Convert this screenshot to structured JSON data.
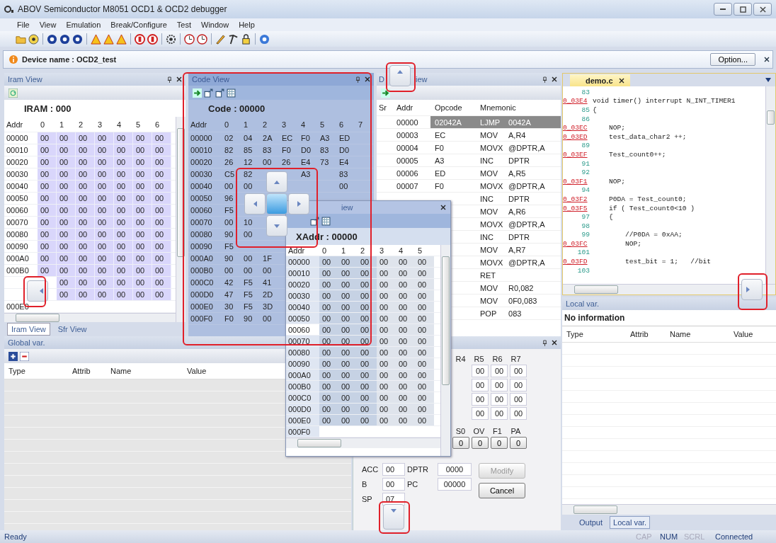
{
  "window": {
    "title": "ABOV Semiconductor M8051 OCD1 & OCD2 debugger"
  },
  "menu": [
    "File",
    "View",
    "Emulation",
    "Break/Configure",
    "Test",
    "Window",
    "Help"
  ],
  "device_bar": {
    "label": "Device name : OCD2_test",
    "button": "Option..."
  },
  "iram_view": {
    "title": "Iram View",
    "label": "IRAM : 000",
    "columns": [
      "Addr",
      "0",
      "1",
      "2",
      "3",
      "4",
      "5",
      "6"
    ],
    "rows": [
      [
        "00000",
        "00",
        "00",
        "00",
        "00",
        "00",
        "00",
        "00"
      ],
      [
        "00010",
        "00",
        "00",
        "00",
        "00",
        "00",
        "00",
        "00"
      ],
      [
        "00020",
        "00",
        "00",
        "00",
        "00",
        "00",
        "00",
        "00"
      ],
      [
        "00030",
        "00",
        "00",
        "00",
        "00",
        "00",
        "00",
        "00"
      ],
      [
        "00040",
        "00",
        "00",
        "00",
        "00",
        "00",
        "00",
        "00"
      ],
      [
        "00050",
        "00",
        "00",
        "00",
        "00",
        "00",
        "00",
        "00"
      ],
      [
        "00060",
        "00",
        "00",
        "00",
        "00",
        "00",
        "00",
        "00"
      ],
      [
        "00070",
        "00",
        "00",
        "00",
        "00",
        "00",
        "00",
        "00"
      ],
      [
        "00080",
        "00",
        "00",
        "00",
        "00",
        "00",
        "00",
        "00"
      ],
      [
        "00090",
        "00",
        "00",
        "00",
        "00",
        "00",
        "00",
        "00"
      ],
      [
        "000A0",
        "00",
        "00",
        "00",
        "00",
        "00",
        "00",
        "00"
      ],
      [
        "000B0",
        "00",
        "00",
        "00",
        "00",
        "00",
        "00",
        "00"
      ],
      [
        null,
        null,
        "00",
        "00",
        "00",
        "00",
        "00",
        "00"
      ],
      [
        null,
        null,
        "00",
        "00",
        "00",
        "00",
        "00",
        "00"
      ],
      [
        "000E0"
      ]
    ]
  },
  "iram_tabs": [
    {
      "label": "Iram View",
      "selected": true
    },
    {
      "label": "Sfr View",
      "selected": false
    }
  ],
  "global_var": {
    "title": "Global var.",
    "columns": [
      "Type",
      "Attrib",
      "Name",
      "Value"
    ]
  },
  "code_view": {
    "title": "Code View",
    "label": "Code : 00000",
    "columns": [
      "Addr",
      "0",
      "1",
      "2",
      "3",
      "4",
      "5",
      "6",
      "7"
    ],
    "rows": [
      [
        "00000",
        "02",
        "04",
        "2A",
        "EC",
        "F0",
        "A3",
        "ED"
      ],
      [
        "00010",
        "82",
        "85",
        "83",
        "F0",
        "D0",
        "83",
        "D0"
      ],
      [
        "00020",
        "26",
        "12",
        "00",
        "26",
        "E4",
        "73",
        "E4"
      ],
      [
        "00030",
        "C5",
        "82",
        null,
        null,
        "A3",
        null,
        "83"
      ],
      [
        "00040",
        "00",
        "00",
        null,
        null,
        null,
        null,
        "00"
      ],
      [
        "00050",
        "96"
      ],
      [
        "00060",
        "F5"
      ],
      [
        "00070",
        "00",
        "10"
      ],
      [
        "00080",
        "90",
        "00"
      ],
      [
        "00090",
        "F5"
      ],
      [
        "000A0",
        "90",
        "00",
        "1F"
      ],
      [
        "000B0",
        "00",
        "00",
        "00"
      ],
      [
        "000C0",
        "42",
        "F5",
        "41"
      ],
      [
        "000D0",
        "47",
        "F5",
        "2D"
      ],
      [
        "000E0",
        "30",
        "F5",
        "3D"
      ],
      [
        "000F0",
        "F0",
        "90",
        "00"
      ]
    ]
  },
  "disasm_view": {
    "title_parts": [
      "D",
      "iew"
    ],
    "columns": [
      "Sr",
      "Addr",
      "Opcode",
      "Mnemonic"
    ],
    "rows": [
      {
        "addr": "00000",
        "opcode": "02042A",
        "instr": "LJMP",
        "operand": "0042A",
        "selected": true
      },
      {
        "addr": "00003",
        "opcode": "EC",
        "instr": "MOV",
        "operand": "A,R4",
        "selected": false
      },
      {
        "addr": "00004",
        "opcode": "F0",
        "instr": "MOVX",
        "operand": "@DPTR,A",
        "selected": false
      },
      {
        "addr": "00005",
        "opcode": "A3",
        "instr": "INC",
        "operand": "DPTR",
        "selected": false
      },
      {
        "addr": "00006",
        "opcode": "ED",
        "instr": "MOV",
        "operand": "A,R5",
        "selected": false
      },
      {
        "addr": "00007",
        "opcode": "F0",
        "instr": "MOVX",
        "operand": "@DPTR,A",
        "selected": false
      },
      {
        "instr": "INC",
        "operand": "DPTR",
        "selected": false
      },
      {
        "instr": "MOV",
        "operand": "A,R6",
        "selected": false
      },
      {
        "instr": "MOVX",
        "operand": "@DPTR,A",
        "selected": false
      },
      {
        "instr": "INC",
        "operand": "DPTR",
        "selected": false
      },
      {
        "instr": "MOV",
        "operand": "A,R7",
        "selected": false
      },
      {
        "instr": "MOVX",
        "operand": "@DPTR,A",
        "selected": false
      },
      {
        "instr": "RET",
        "selected": false
      },
      {
        "instr": "MOV",
        "operand": "R0,082",
        "selected": false
      },
      {
        "instr": "MOV",
        "operand": "0F0,083",
        "selected": false
      },
      {
        "instr": "POP",
        "operand": "083",
        "selected": false
      }
    ]
  },
  "xaddr_window": {
    "title": "iew",
    "label": "XAddr : 00000",
    "columns": [
      "Addr",
      "0",
      "1",
      "2",
      "3",
      "4",
      "5"
    ],
    "rows": [
      {
        "cells": [
          "00000",
          "00",
          "00",
          "00",
          "00",
          "00",
          "00"
        ],
        "selected": false
      },
      {
        "cells": [
          "00010",
          "00",
          "00",
          "00",
          "00",
          "00",
          "00"
        ],
        "selected": false
      },
      {
        "cells": [
          "00020",
          "00",
          "00",
          "00",
          "00",
          "00",
          "00"
        ],
        "selected": false
      },
      {
        "cells": [
          "00030",
          "00",
          "00",
          "00",
          "00",
          "00",
          "00"
        ],
        "selected": false
      },
      {
        "cells": [
          "00040",
          "00",
          "00",
          "00",
          "00",
          "00",
          "00"
        ],
        "selected": false
      },
      {
        "cells": [
          "00050",
          "00",
          "00",
          "00",
          "00",
          "00",
          "00"
        ],
        "selected": false
      },
      {
        "cells": [
          "00060",
          "00",
          "00",
          "00",
          "00",
          "00",
          "00"
        ],
        "selected": true
      },
      {
        "cells": [
          "00070",
          "00",
          "00",
          "00",
          "00",
          "00",
          "00"
        ],
        "selected": false
      },
      {
        "cells": [
          "00080",
          "00",
          "00",
          "00",
          "00",
          "00",
          "00"
        ],
        "selected": false
      },
      {
        "cells": [
          "00090",
          "00",
          "00",
          "00",
          "00",
          "00",
          "00"
        ],
        "selected": false
      },
      {
        "cells": [
          "000A0",
          "00",
          "00",
          "00",
          "00",
          "00",
          "00"
        ],
        "selected": false
      },
      {
        "cells": [
          "000B0",
          "00",
          "00",
          "00",
          "00",
          "00",
          "00"
        ],
        "selected": false
      },
      {
        "cells": [
          "000C0",
          "00",
          "00",
          "00",
          "00",
          "00",
          "00"
        ],
        "selected": false
      },
      {
        "cells": [
          "000D0",
          "00",
          "00",
          "00",
          "00",
          "00",
          "00"
        ],
        "selected": false
      },
      {
        "cells": [
          "000E0",
          "00",
          "00",
          "00",
          "00",
          "00",
          "00"
        ],
        "selected": false
      },
      {
        "cells": [
          "000F0"
        ],
        "selected": false
      }
    ]
  },
  "registers": {
    "bank_columns": [
      "R4",
      "R5",
      "R6",
      "R7"
    ],
    "bank_rows": [
      [
        "00",
        "00",
        "00"
      ],
      [
        "00",
        "00",
        "00"
      ],
      [
        "00",
        "00",
        "00"
      ],
      [
        "00",
        "00",
        "00"
      ]
    ],
    "flag_columns": [
      "S0",
      "OV",
      "F1",
      "PA"
    ],
    "flag_values": [
      "0",
      "0",
      "0",
      "0"
    ],
    "fields": [
      {
        "label": "ACC",
        "value": "00"
      },
      {
        "label": "DPTR",
        "value": "0000"
      },
      {
        "label": "B",
        "value": "00"
      },
      {
        "label": "PC",
        "value": "00000"
      },
      {
        "label": "SP",
        "value": "07"
      }
    ],
    "buttons": [
      {
        "label": "Modify",
        "disabled": true
      },
      {
        "label": "Cancel",
        "disabled": false
      }
    ]
  },
  "editor": {
    "tab": "demo.c",
    "lines": [
      {
        "kind": "line",
        "gutter": "83"
      },
      {
        "kind": "addr",
        "gutter": "0_03E4",
        "code": "void timer() interrupt N_INT_TIMER1"
      },
      {
        "kind": "line",
        "gutter": "85",
        "code": "{"
      },
      {
        "kind": "line",
        "gutter": "86"
      },
      {
        "kind": "addr",
        "gutter": "0_03EC",
        "code": "    NOP;"
      },
      {
        "kind": "addr",
        "gutter": "0_03ED",
        "code": "    test_data_char2 ++;"
      },
      {
        "kind": "line",
        "gutter": "89"
      },
      {
        "kind": "addr",
        "gutter": "0_03EF",
        "code": "    Test_count0++;"
      },
      {
        "kind": "line",
        "gutter": "91"
      },
      {
        "kind": "line",
        "gutter": "92"
      },
      {
        "kind": "addr",
        "gutter": "0_03F1",
        "code": "    NOP;"
      },
      {
        "kind": "line",
        "gutter": "94"
      },
      {
        "kind": "addr",
        "gutter": "0_03F2",
        "code": "    P0DA = Test_count0;"
      },
      {
        "kind": "addr",
        "gutter": "0_03F5",
        "code": "    if ( Test_count0<10 )"
      },
      {
        "kind": "line",
        "gutter": "97",
        "code": "    {"
      },
      {
        "kind": "line",
        "gutter": "98"
      },
      {
        "kind": "line",
        "gutter": "99",
        "code": "        //P0DA = 0xAA;"
      },
      {
        "kind": "addr",
        "gutter": "0_03FC",
        "code": "        NOP;"
      },
      {
        "kind": "line",
        "gutter": "101"
      },
      {
        "kind": "addr",
        "gutter": "0_03FD",
        "code": "        test_bit = 1;   //bit"
      },
      {
        "kind": "line",
        "gutter": "103"
      }
    ]
  },
  "local_var": {
    "title": "Local var.",
    "message": "No information",
    "columns": [
      "Type",
      "Attrib",
      "Name",
      "Value"
    ]
  },
  "bottom_tabs": [
    {
      "label": "Output",
      "selected": false
    },
    {
      "label": "Local var.",
      "selected": true
    }
  ],
  "status_bar": {
    "text": "Ready",
    "indicators": [
      {
        "label": "CAP",
        "on": false
      },
      {
        "label": "NUM",
        "on": true
      },
      {
        "label": "SCRL",
        "on": false
      }
    ],
    "connection": "Connected"
  }
}
